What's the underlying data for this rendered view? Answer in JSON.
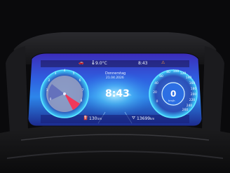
{
  "status_bar": {
    "temperature": "9.0°C",
    "time": "8:43"
  },
  "center": {
    "day": "Donnerstag",
    "date": "21.04.2026",
    "clock": "8:43",
    "clock_unit": "h"
  },
  "rpm_gauge": {
    "ticks": [
      "1",
      "2",
      "3",
      "4",
      "5",
      "6",
      "7",
      "8"
    ],
    "zero": "0",
    "unit": "x1000"
  },
  "speed_gauge": {
    "value": "0",
    "ticks": [
      "20",
      "40",
      "60",
      "80",
      "100",
      "120",
      "140",
      "160",
      "180",
      "200",
      "220",
      "240",
      "260"
    ],
    "zero": "0",
    "unit": "km/h"
  },
  "bottom": {
    "range": "130",
    "range_unit": "km",
    "odometer": "13699",
    "odometer_unit": "km"
  },
  "colors": {
    "screen_top": "#4a38c9",
    "screen_mid": "#2e8ff0",
    "accent_cyan": "#7ef2ff",
    "rpm_fill": "#9aa3c3",
    "rpm_red": "#f0385a"
  },
  "icons": {
    "temp_icon": "thermometer-icon",
    "car_icon": "car-icon",
    "fuel_icon": "fuel-pump-icon",
    "odometer_icon": "road-icon",
    "warning_icon": "warning-lamp-icon"
  }
}
